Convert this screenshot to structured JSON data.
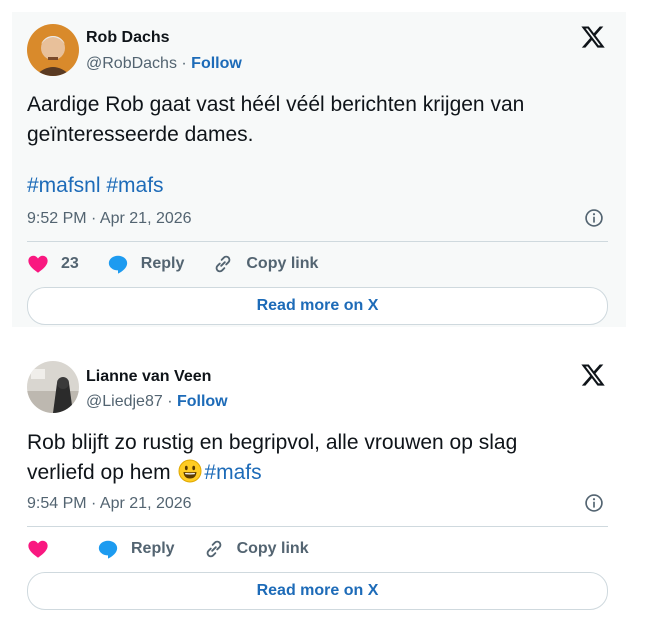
{
  "tweets": [
    {
      "author_name": "Rob Dachs",
      "handle": "@RobDachs",
      "separator": " · ",
      "follow_label": "Follow",
      "text_line1": "Aardige Rob gaat vast héél véél berichten krijgen van",
      "text_line2": "geïnteresseerde dames.",
      "hashtag1": "#mafsnl",
      "hashtag2": "#mafs",
      "timestamp": "9:52 PM · Apr 21, 2026",
      "like_count": "23",
      "reply_label": "Reply",
      "copy_label": "Copy link",
      "read_more_label": "Read more on X",
      "icons": [
        "x-logo",
        "info-icon",
        "heart-icon",
        "reply-icon",
        "link-icon"
      ]
    },
    {
      "author_name": "Lianne van Veen",
      "handle": "@Liedje87",
      "separator": " · ",
      "follow_label": "Follow",
      "text_line1": "Rob blijft zo rustig en begripvol, alle vrouwen op slag",
      "text_line2": "verliefd op hem",
      "hashtag1": "#mafs",
      "timestamp": "9:54 PM · Apr 21, 2026",
      "reply_label": "Reply",
      "copy_label": "Copy link",
      "read_more_label": "Read more on X",
      "icons": [
        "x-logo",
        "smiley-emoji",
        "info-icon",
        "heart-icon",
        "reply-icon",
        "link-icon"
      ]
    }
  ],
  "colors": {
    "link_blue": "#1d6bb8",
    "like_pink": "#f91880",
    "reply_blue": "#1d9bf0",
    "muted_gray": "#536471",
    "card_bg": "#f7f9f9"
  }
}
